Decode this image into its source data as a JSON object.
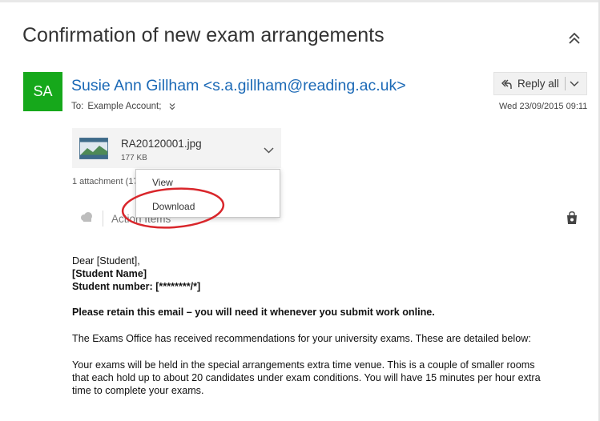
{
  "message": {
    "subject": "Confirmation of new exam arrangements",
    "avatar_initials": "SA",
    "avatar_color": "#16a81b",
    "sender": "Susie Ann Gillham <s.a.gillham@reading.ac.uk>",
    "to_label": "To:",
    "to_value": "Example Account;",
    "date": "Wed 23/09/2015 09:11",
    "reply_label": "Reply all"
  },
  "attachment": {
    "filename": "RA20120001.jpg",
    "size": "177 KB",
    "count_text": "1 attachment (17"
  },
  "context_menu": {
    "items": [
      "View",
      "Download"
    ],
    "highlighted_item": "Download",
    "highlight_color": "#d9262b"
  },
  "actions": {
    "label": "Action Items"
  },
  "body": {
    "greeting": "Dear [Student],",
    "student_name": "[Student Name]",
    "student_number": "Student number: [********/*]",
    "retain_notice": "Please retain this email – you will need it whenever you submit work online.",
    "para1": "The Exams Office has received recommendations for your university exams. These are detailed below:",
    "para2_line1": "Your exams will be held in the special arrangements extra time venue.  This is a couple of smaller rooms",
    "para2_line2": "that each hold up to about 20 candidates under exam conditions. You will have 15 minutes per hour extra",
    "para2_line3": "time to complete your exams."
  },
  "colors": {
    "link": "#1b69b6"
  }
}
